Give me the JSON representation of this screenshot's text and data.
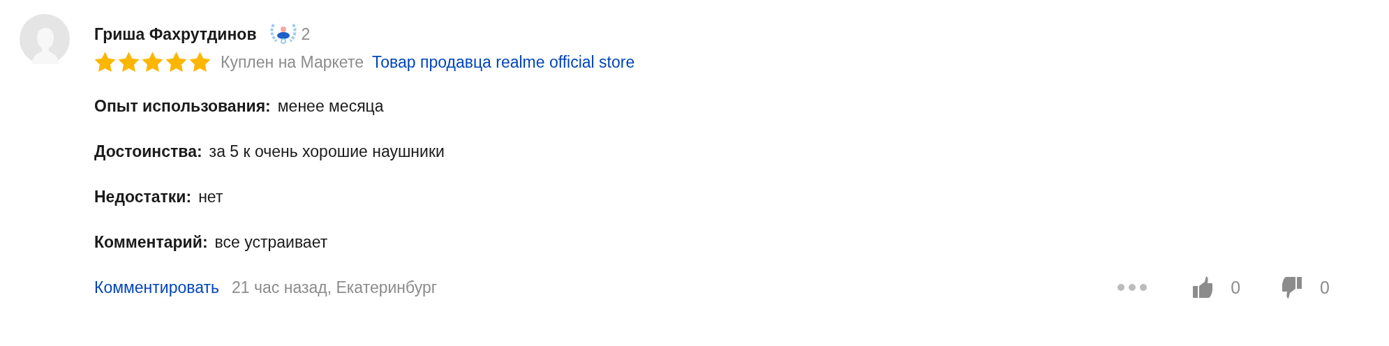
{
  "review": {
    "author": "Гриша Фахрутдинов",
    "badge_count": "2",
    "stars": 5,
    "purchase_note": "Куплен на Маркете",
    "seller_link": "Товар продавца realme official store",
    "sections": [
      {
        "label": "Опыт использования:",
        "text": "менее месяца"
      },
      {
        "label": "Достоинства:",
        "text": "за 5 к очень хорошие наушники"
      },
      {
        "label": "Недостатки:",
        "text": "нет"
      },
      {
        "label": "Комментарий:",
        "text": "все устраивает"
      }
    ],
    "comment_link": "Комментировать",
    "meta": "21 час назад, Екатеринбург",
    "likes": "0",
    "dislikes": "0"
  }
}
